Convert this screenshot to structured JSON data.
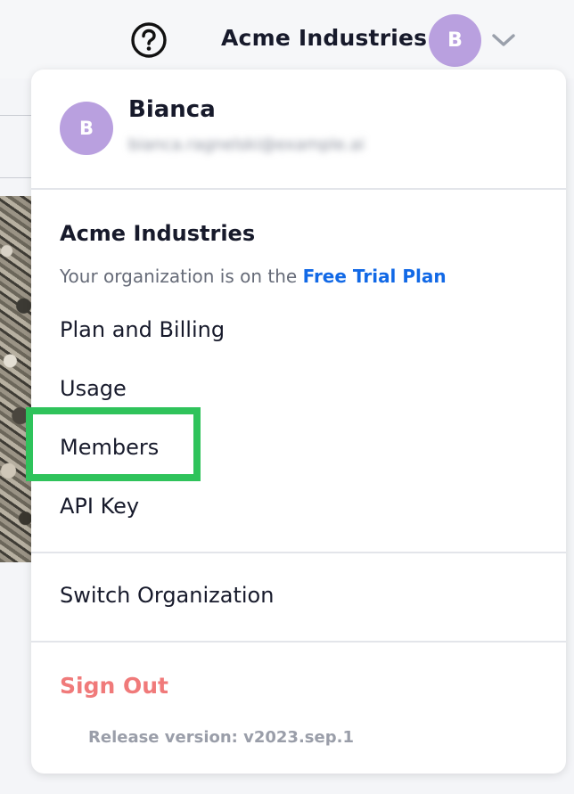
{
  "header": {
    "org_name": "Acme Industries",
    "avatar_initial": "B",
    "icons": [
      "help-circle-icon",
      "chevron-down-icon"
    ]
  },
  "menu": {
    "user": {
      "initial": "B",
      "name": "Bianca",
      "email": "bianca.ragnelski@example.ai"
    },
    "organization": {
      "name": "Acme Industries",
      "plan_prefix": "Your organization is on the ",
      "plan_name": "Free Trial Plan"
    },
    "items": [
      {
        "label": "Plan and Billing"
      },
      {
        "label": "Usage"
      },
      {
        "label": "Members"
      },
      {
        "label": "API Key"
      }
    ],
    "switch_org_label": "Switch Organization",
    "sign_out_label": "Sign Out",
    "release_version": "Release version: v2023.sep.1"
  },
  "colors": {
    "accent_link": "#1269e6",
    "avatar": "#b9a0df",
    "sign_out": "#f07a7a",
    "highlight": "#2fc35b"
  }
}
